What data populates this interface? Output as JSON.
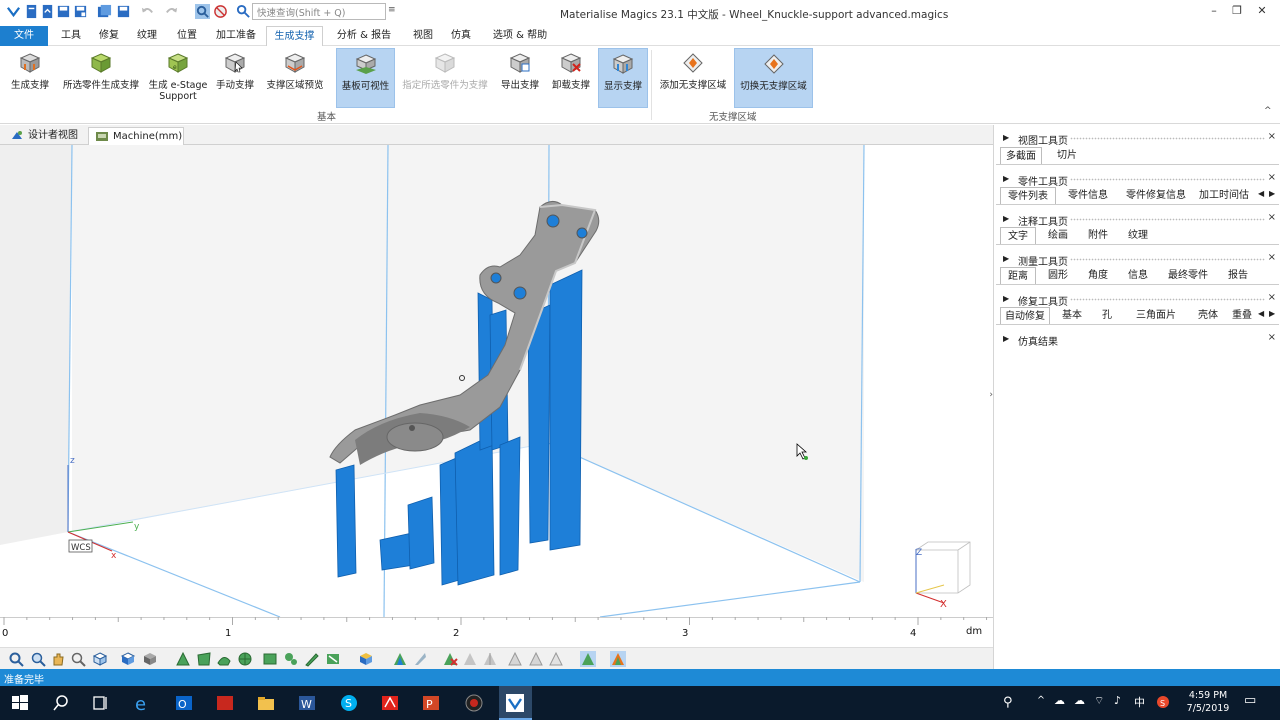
{
  "window": {
    "title": "Materialise Magics 23.1 中文版 - Wheel_Knuckle-support advanced.magics",
    "quick_search_placeholder": "快速查询(Shift + Q)",
    "controls": [
      "minimize",
      "restore",
      "close"
    ]
  },
  "menu": {
    "items": [
      "文件",
      "工具",
      "修复",
      "纹理",
      "位置",
      "加工准备",
      "生成支撑",
      "分析 & 报告",
      "视图",
      "仿真",
      "选项 & 帮助"
    ],
    "active": "生成支撑"
  },
  "ribbon": {
    "basic_group": {
      "label": "基本",
      "buttons": [
        {
          "label": "生成支撑",
          "state": "normal"
        },
        {
          "label": "所选零件生成支撑",
          "state": "normal"
        },
        {
          "label": "生成 e-Stage Support",
          "state": "normal"
        },
        {
          "label": "手动支撑",
          "state": "normal"
        },
        {
          "label": "支撑区域预览",
          "state": "normal"
        },
        {
          "label": "基板可视性",
          "state": "highlight"
        },
        {
          "label": "指定所选零件为支撑",
          "state": "disabled"
        },
        {
          "label": "导出支撑",
          "state": "normal"
        },
        {
          "label": "卸载支撑",
          "state": "normal"
        },
        {
          "label": "显示支撑",
          "state": "highlight"
        }
      ]
    },
    "nosupport_group": {
      "label": "无支撑区域",
      "buttons": [
        {
          "label": "添加无支撑区域",
          "state": "normal"
        },
        {
          "label": "切换无支撑区域",
          "state": "highlight"
        }
      ]
    }
  },
  "doc_tabs": [
    {
      "label": "设计者视图",
      "active": false
    },
    {
      "label": "Machine(mm)",
      "active": true
    }
  ],
  "viewport": {
    "axis_labels": {
      "z": "z",
      "y": "y",
      "x": "x",
      "wcs": "WCS"
    },
    "viewcube_labels": {
      "z": "Z",
      "x": "X"
    },
    "colors": {
      "part": "#9a9a9a",
      "support": "#1e7fd8",
      "platform_edge": "#8bc2f0"
    }
  },
  "ruler": {
    "ticks": [
      "0",
      "1",
      "2",
      "3",
      "4"
    ],
    "unit": "dm"
  },
  "right_panel": {
    "pages": [
      {
        "title": "视图工具页",
        "tabs": [
          "多截面",
          "切片"
        ],
        "active_tab": "多截面"
      },
      {
        "title": "零件工具页",
        "tabs": [
          "零件列表",
          "零件信息",
          "零件修复信息",
          "加工时间估"
        ],
        "active_tab": "零件列表"
      },
      {
        "title": "注释工具页",
        "tabs": [
          "文字",
          "绘画",
          "附件",
          "纹理"
        ],
        "active_tab": "文字"
      },
      {
        "title": "测量工具页",
        "tabs": [
          "距离",
          "圆形",
          "角度",
          "信息",
          "最终零件",
          "报告"
        ],
        "active_tab": "距离"
      },
      {
        "title": "修复工具页",
        "tabs": [
          "自动修复",
          "基本",
          "孔",
          "三角面片",
          "壳体",
          "重叠"
        ],
        "active_tab": "自动修复"
      },
      {
        "title": "仿真结果",
        "tabs": [],
        "active_tab": ""
      }
    ]
  },
  "status": {
    "text": "准备完毕"
  },
  "taskbar": {
    "apps": [
      "start",
      "search",
      "task-view",
      "edge",
      "outlook",
      "foxit",
      "explorer",
      "word",
      "skype",
      "acrobat",
      "powerpoint",
      "recorder",
      "magics"
    ],
    "tray_ime": "中",
    "time": "4:59 PM",
    "date": "7/5/2019"
  }
}
